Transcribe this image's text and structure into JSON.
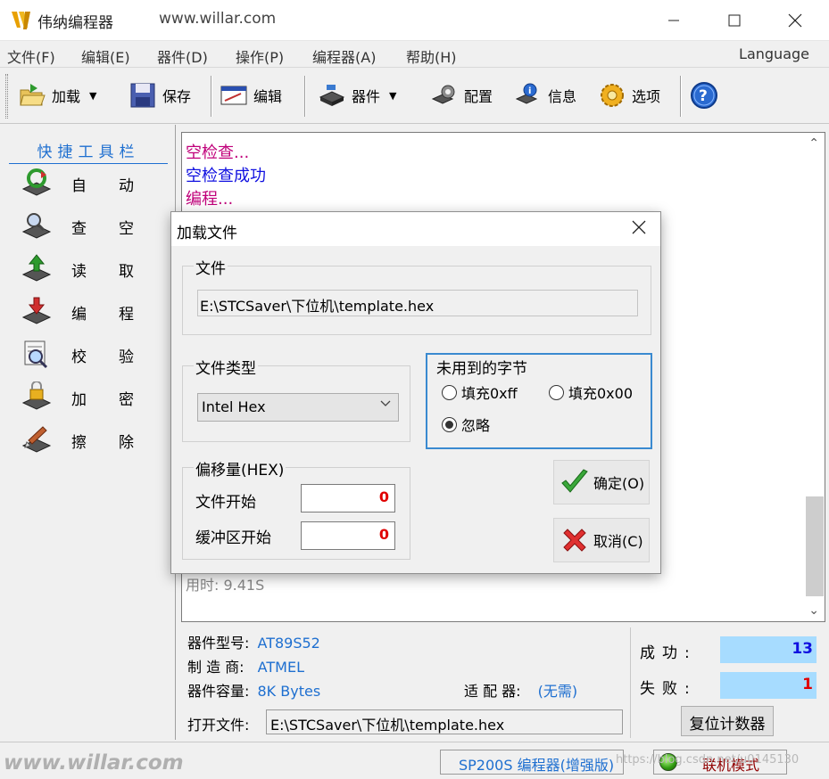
{
  "window": {
    "title": "伟纳编程器",
    "url": "www.willar.com",
    "minimize_icon": "minimize-icon",
    "maximize_icon": "maximize-icon",
    "close_icon": "close-icon"
  },
  "menu": {
    "items": [
      "文件(F)",
      "编辑(E)",
      "器件(D)",
      "操作(P)",
      "编程器(A)",
      "帮助(H)"
    ],
    "language": "Language"
  },
  "toolbar": {
    "load": "加载",
    "save": "保存",
    "edit": "编辑",
    "device": "器件",
    "config": "配置",
    "info": "信息",
    "options": "选项",
    "help_icon": "help-icon"
  },
  "quickbar": {
    "title": "快捷工具栏",
    "items": [
      "自动",
      "查空",
      "读取",
      "编程",
      "校验",
      "加密",
      "擦除"
    ]
  },
  "log": {
    "lines": [
      {
        "text": "空检查...",
        "color": "#c0007a"
      },
      {
        "text": "空检查成功",
        "color": "#1010e0"
      },
      {
        "text": "编程...",
        "color": "#c0007a"
      }
    ],
    "faded": "用时: 9.41S"
  },
  "device_info": {
    "model_label": "器件型号:",
    "model_value": "AT89S52",
    "maker_label": "制 造 商:",
    "maker_value": "ATMEL",
    "capacity_label": "器件容量:",
    "capacity_value": "8K Bytes",
    "adapter_label": "适 配 器:",
    "adapter_value": "(无需)",
    "open_file_label": "打开文件:",
    "open_file_value": "E:\\STCSaver\\下位机\\template.hex"
  },
  "stats": {
    "success_label": "成功:",
    "success_value": "13",
    "success_color": "#1010e0",
    "fail_label": "失败:",
    "fail_value": "1",
    "fail_color": "#e00000",
    "reset_label": "复位计数器"
  },
  "statusbar": {
    "url": "www.willar.com",
    "device": "SP200S 编程器(增强版)",
    "mode": "联机模式",
    "watermark": "https://blog.csdn.net/u0145130"
  },
  "dialog": {
    "title": "加载文件",
    "file_group": "文件",
    "file_path": "E:\\STCSaver\\下位机\\template.hex",
    "type_group": "文件类型",
    "type_value": "Intel Hex",
    "unused_group": "未用到的字节",
    "fill_ff": "填充0xff",
    "fill_00": "填充0x00",
    "ignore": "忽略",
    "offset_group": "偏移量(HEX)",
    "file_start_label": "文件开始",
    "file_start_value": "0",
    "buffer_start_label": "缓冲区开始",
    "buffer_start_value": "0",
    "ok": "确定(O)",
    "cancel": "取消(C)"
  }
}
